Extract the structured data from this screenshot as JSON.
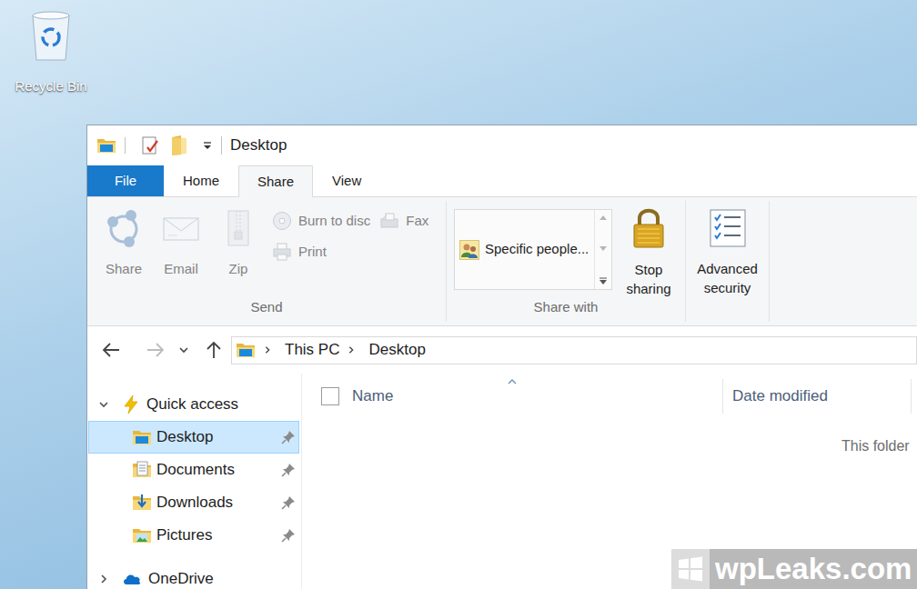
{
  "desktop": {
    "icons": [
      {
        "label": "Recycle Bin"
      }
    ]
  },
  "window": {
    "title": "Desktop"
  },
  "ribbon": {
    "tabs": [
      {
        "label": "File",
        "kind": "backstage",
        "selected": false
      },
      {
        "label": "Home",
        "kind": "tab",
        "selected": false
      },
      {
        "label": "Share",
        "kind": "tab",
        "selected": true
      },
      {
        "label": "View",
        "kind": "tab",
        "selected": false
      }
    ],
    "send_group": {
      "label": "Send",
      "large_buttons": [
        {
          "label": "Share",
          "disabled": true
        },
        {
          "label": "Email",
          "disabled": true
        },
        {
          "label": "Zip",
          "disabled": true
        }
      ],
      "small_buttons": [
        {
          "label": "Burn to disc",
          "disabled": true
        },
        {
          "label": "Print",
          "disabled": true
        },
        {
          "label": "Fax",
          "disabled": true
        }
      ]
    },
    "share_with_group": {
      "label": "Share with",
      "list": [
        {
          "label": "Specific people...",
          "selected": false
        }
      ],
      "buttons": [
        {
          "label": "Stop sharing",
          "disabled": false
        }
      ]
    },
    "security_group": {
      "buttons": [
        {
          "label": "Advanced security",
          "disabled": false
        }
      ]
    }
  },
  "address_bar": {
    "back_disabled": false,
    "forward_disabled": true,
    "path": [
      {
        "label": "This PC"
      },
      {
        "label": "Desktop"
      }
    ]
  },
  "navigation": {
    "items": [
      {
        "label": "Quick access",
        "kind": "quick-access",
        "level": 0,
        "expanded": true,
        "selected": false,
        "pinned": false
      },
      {
        "label": "Desktop",
        "kind": "desktop",
        "level": 1,
        "selected": true,
        "pinned": true
      },
      {
        "label": "Documents",
        "kind": "documents",
        "level": 1,
        "selected": false,
        "pinned": true
      },
      {
        "label": "Downloads",
        "kind": "downloads",
        "level": 1,
        "selected": false,
        "pinned": true
      },
      {
        "label": "Pictures",
        "kind": "pictures",
        "level": 1,
        "selected": false,
        "pinned": true
      },
      {
        "label": "OneDrive",
        "kind": "onedrive",
        "level": 0,
        "expanded": false,
        "selected": false,
        "pinned": false
      }
    ]
  },
  "file_list": {
    "select_all_checked": false,
    "columns": [
      {
        "label": "Name",
        "sorted": true
      },
      {
        "label": "Date modified",
        "sorted": false
      }
    ],
    "empty_message": "This folder"
  },
  "watermark": {
    "text": "wpLeaks.com"
  }
}
